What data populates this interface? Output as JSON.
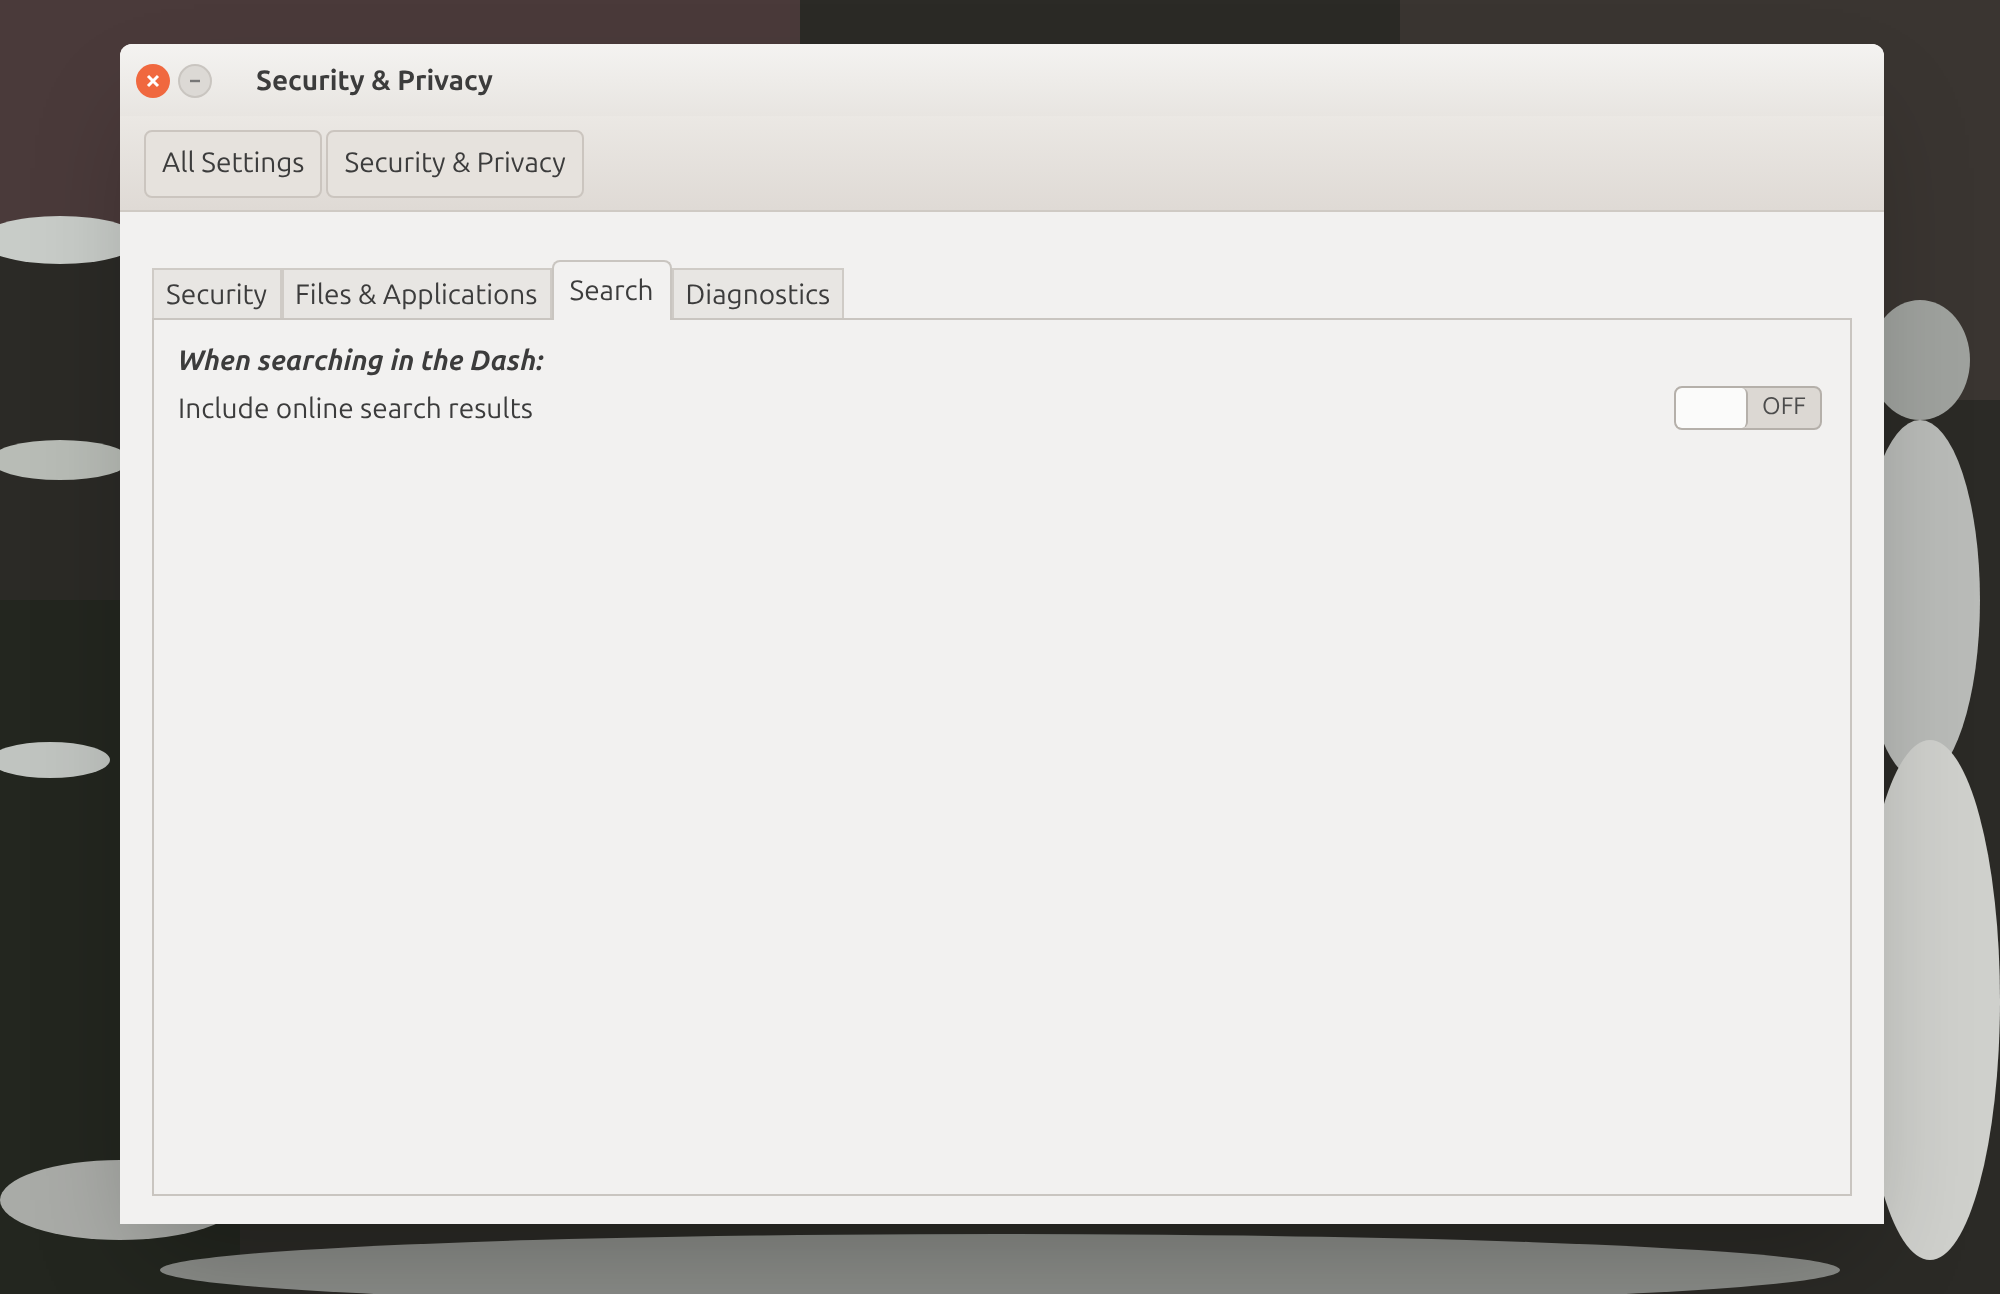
{
  "window": {
    "title": "Security & Privacy"
  },
  "breadcrumbs": [
    "All Settings",
    "Security & Privacy"
  ],
  "tabs": [
    {
      "label": "Security",
      "selected": false
    },
    {
      "label": "Files & Applications",
      "selected": false
    },
    {
      "label": "Search",
      "selected": true
    },
    {
      "label": "Diagnostics",
      "selected": false
    }
  ],
  "search_panel": {
    "heading": "When searching in the Dash:",
    "option": {
      "label": "Include online search results",
      "on": false,
      "switch_text": "OFF"
    }
  }
}
